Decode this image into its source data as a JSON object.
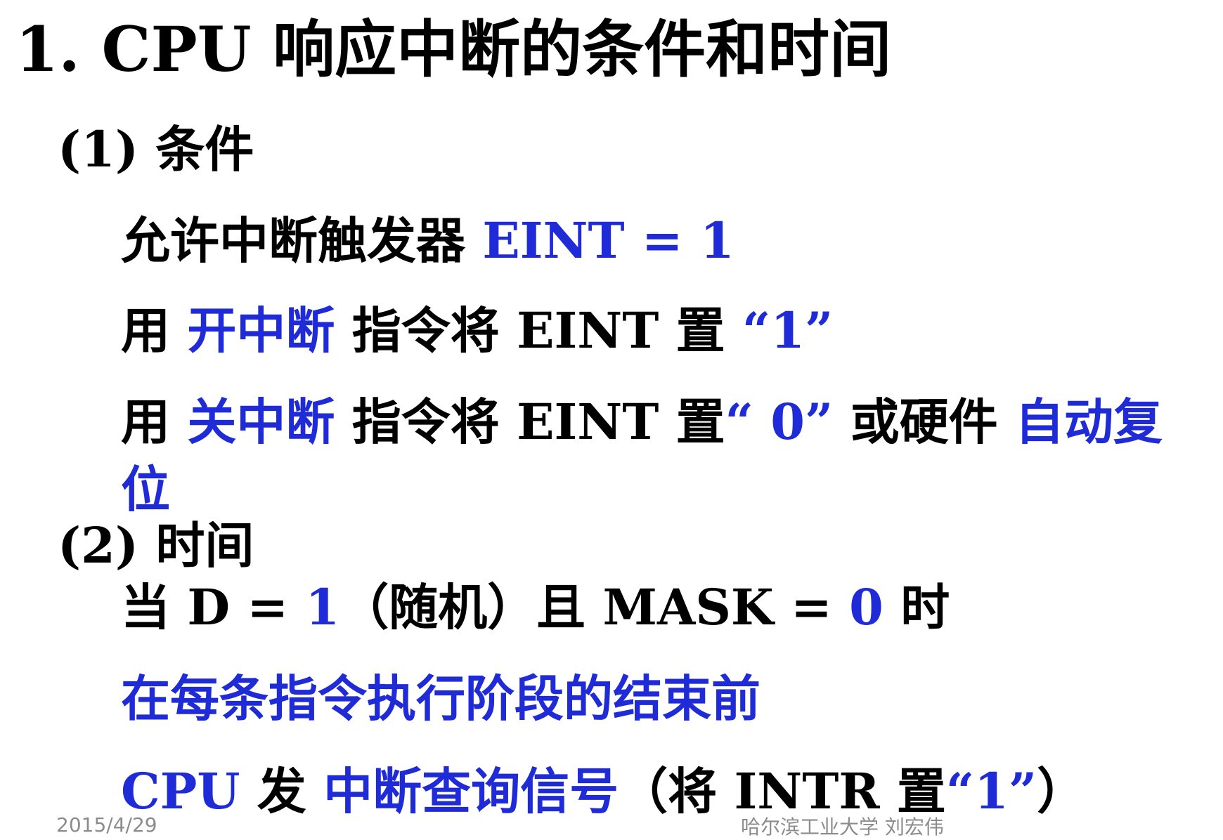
{
  "title": "1. CPU 响应中断的条件和时间",
  "section1": {
    "label": "(1) 条件"
  },
  "cond1": {
    "text": "允许中断触发器 ",
    "value": "EINT = 1"
  },
  "cond2": {
    "prefix": "用 ",
    "op": "开中断",
    "middle": " 指令将 EINT 置 ",
    "value": "“1”"
  },
  "cond3": {
    "prefix": "用 ",
    "op": "关中断",
    "middle": " 指令将 EINT 置",
    "value": "“ 0”",
    "middle2": " 或硬件 ",
    "tail": "自动复",
    "tail2": "位"
  },
  "section2": {
    "label": "(2) 时间"
  },
  "time1": {
    "p1": "当 D = ",
    "v1": "1",
    "p2": "（随机）且 MASK = ",
    "v2": "0",
    "p3": " 时"
  },
  "time2": {
    "text": "在每条指令执行阶段的结束前"
  },
  "time3": {
    "cpu": "CPU",
    "p1": " 发 ",
    "signal": "中断查询信号",
    "p2": "（将 INTR 置",
    "value": "“1”",
    "p3": "）"
  },
  "footer": {
    "date": "2015/4/29",
    "author": "哈尔滨工业大学  刘宏伟"
  },
  "colors": {
    "accent": "#1f2bd6",
    "text": "#000000",
    "footer": "#8c8c8c"
  }
}
